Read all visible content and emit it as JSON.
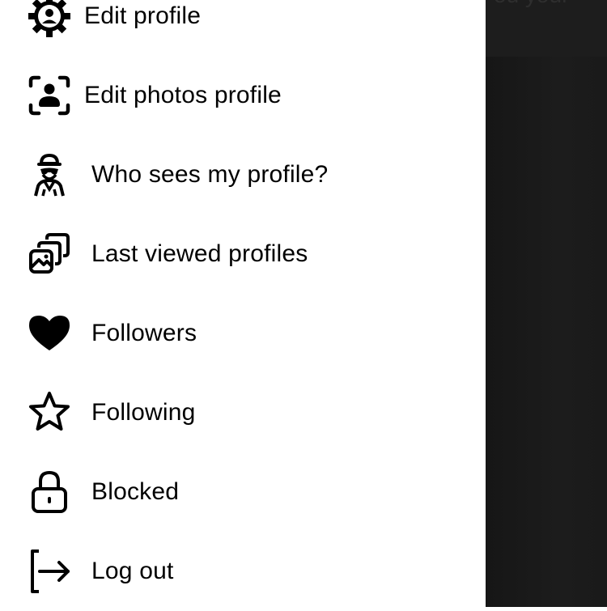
{
  "menu": {
    "items": [
      {
        "label": "Edit profile",
        "icon": "settings-user-icon"
      },
      {
        "label": "Edit photos profile",
        "icon": "profile-photo-icon"
      },
      {
        "label": "Who sees my profile?",
        "icon": "spy-icon"
      },
      {
        "label": "Last viewed profiles",
        "icon": "gallery-stack-icon"
      },
      {
        "label": "Followers",
        "icon": "heart-icon"
      },
      {
        "label": "Following",
        "icon": "star-icon"
      },
      {
        "label": "Blocked",
        "icon": "lock-icon"
      },
      {
        "label": "Log out",
        "icon": "logout-icon"
      }
    ]
  },
  "background": {
    "peek_text": "ou your"
  }
}
